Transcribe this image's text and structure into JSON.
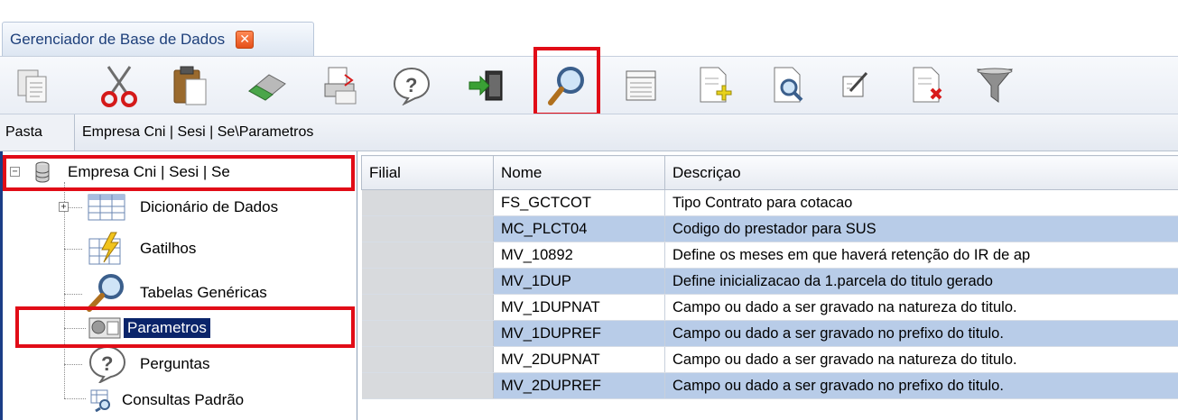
{
  "tab": {
    "title": "Gerenciador de Base de Dados",
    "close_glyph": "✕"
  },
  "toolbar": {
    "buttons": [
      {
        "name": "copy-icon"
      },
      {
        "name": "cut-icon"
      },
      {
        "name": "paste-icon"
      },
      {
        "name": "eraser-icon"
      },
      {
        "name": "print-icon"
      },
      {
        "name": "help-icon"
      },
      {
        "name": "exit-icon"
      },
      {
        "name": "search-icon"
      },
      {
        "name": "table-icon"
      },
      {
        "name": "add-document-icon"
      },
      {
        "name": "preview-document-icon"
      },
      {
        "name": "edit-icon"
      },
      {
        "name": "delete-document-icon"
      },
      {
        "name": "filter-icon"
      }
    ]
  },
  "path": {
    "label": "Pasta",
    "value": "Empresa Cni | Sesi | Se\\Parametros"
  },
  "tree": {
    "root": "Empresa Cni | Sesi | Se",
    "items": [
      {
        "label": "Dicionário de Dados"
      },
      {
        "label": "Gatilhos"
      },
      {
        "label": "Tabelas Genéricas"
      },
      {
        "label": "Parametros"
      },
      {
        "label": "Perguntas"
      },
      {
        "label": "Consultas Padrão"
      }
    ]
  },
  "grid": {
    "columns": [
      "Filial",
      "Nome",
      "Descriçao"
    ],
    "rows": [
      {
        "filial": "",
        "nome": "FS_GCTCOT",
        "desc": "Tipo Contrato para cotacao"
      },
      {
        "filial": "",
        "nome": "MC_PLCT04",
        "desc": "Codigo do prestador para SUS"
      },
      {
        "filial": "",
        "nome": "MV_10892",
        "desc": "Define os meses em que haverá retenção do IR de ap"
      },
      {
        "filial": "",
        "nome": "MV_1DUP",
        "desc": "Define inicializacao da 1.parcela do titulo gerado"
      },
      {
        "filial": "",
        "nome": "MV_1DUPNAT",
        "desc": "Campo ou dado a ser gravado na natureza do titulo."
      },
      {
        "filial": "",
        "nome": "MV_1DUPREF",
        "desc": "Campo ou dado a ser gravado no prefixo do titulo."
      },
      {
        "filial": "",
        "nome": "MV_2DUPNAT",
        "desc": "Campo ou dado a ser gravado na natureza do titulo."
      },
      {
        "filial": "",
        "nome": "MV_2DUPREF",
        "desc": "Campo ou dado a ser gravado no prefixo do titulo."
      }
    ]
  },
  "colors": {
    "highlight": "#e10c17",
    "selection": "#0a246a",
    "alt_row": "#b8cce8"
  }
}
